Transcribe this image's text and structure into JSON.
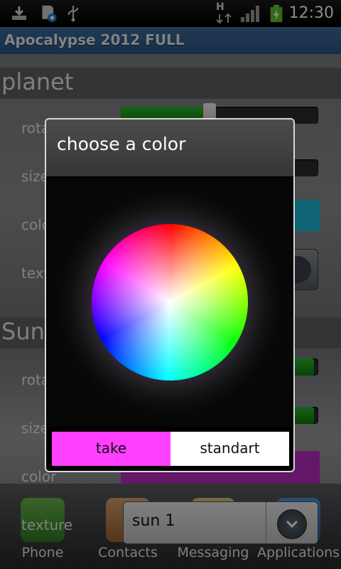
{
  "status_bar": {
    "time": "12:30",
    "icons": [
      "download-icon",
      "sdcard-settings-icon",
      "usb-icon",
      "hspa-data-icon",
      "signal-icon",
      "battery-charging-icon"
    ],
    "network_type": "H"
  },
  "app": {
    "title": "Apocalypse 2012 FULL"
  },
  "settings": {
    "planet": {
      "heading": "planet",
      "rows": [
        "rota",
        "size",
        "colo",
        "textu"
      ]
    },
    "sun": {
      "heading": "Sun",
      "rows": [
        "rota",
        "size",
        "color",
        "texture"
      ]
    },
    "sun_texture_value": "sun 1",
    "colors": {
      "planet_color": "#1cb8d4",
      "sun_color": "#b82ac0",
      "slider_green": "#1f9a1f"
    }
  },
  "dock": {
    "items": [
      {
        "label": "Phone",
        "icon": "phone-icon"
      },
      {
        "label": "Contacts",
        "icon": "contacts-icon"
      },
      {
        "label": "Messaging",
        "icon": "messaging-icon"
      },
      {
        "label": "Applications",
        "icon": "applications-icon"
      }
    ]
  },
  "dialog": {
    "title": "choose a color",
    "take_label": "take",
    "standart_label": "standart",
    "selected_color": "#ff40ff"
  }
}
